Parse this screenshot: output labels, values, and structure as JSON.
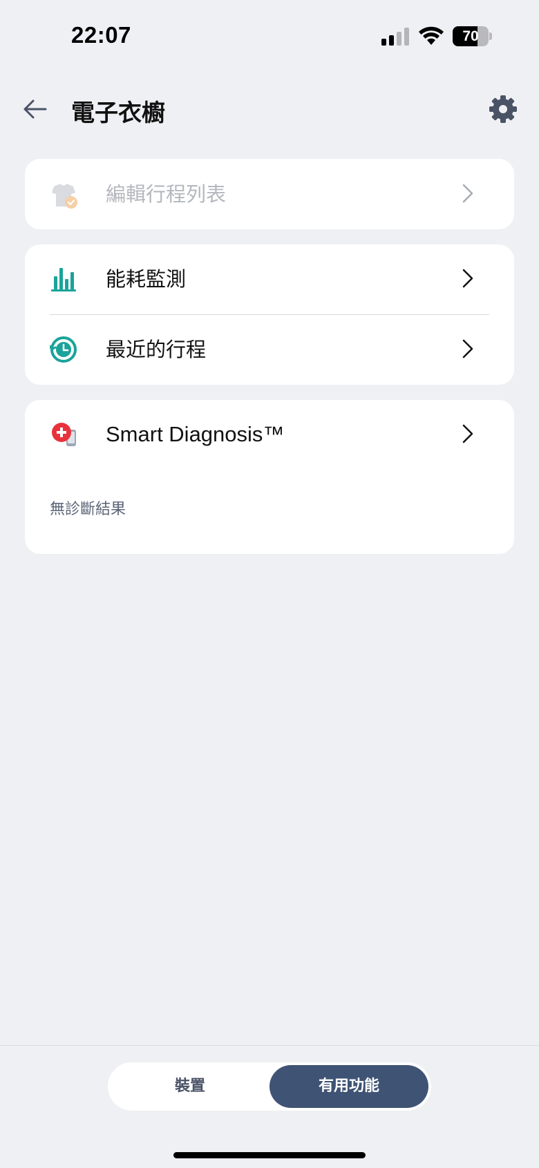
{
  "status_bar": {
    "time": "22:07",
    "battery_level": "70",
    "battery_fraction": 0.7
  },
  "header": {
    "title": "電子衣櫥",
    "back_icon": "arrow-left-icon",
    "settings_icon": "gear-icon"
  },
  "cards": {
    "edit_schedule": {
      "label": "編輯行程列表",
      "icon": "shirt-check-icon",
      "enabled": false
    },
    "energy": {
      "label": "能耗監測",
      "icon": "bar-chart-icon"
    },
    "recent": {
      "label": "最近的行程",
      "icon": "history-clock-icon"
    },
    "diagnosis": {
      "label": "Smart Diagnosis™",
      "icon": "diagnosis-phone-icon",
      "note": "無診斷結果"
    }
  },
  "bottom_tabs": {
    "device": "裝置",
    "features": "有用功能",
    "active": "features"
  },
  "colors": {
    "background": "#eff0f4",
    "teal": "#1aa39a",
    "active_tab": "#3f5374",
    "red": "#e8323c"
  }
}
